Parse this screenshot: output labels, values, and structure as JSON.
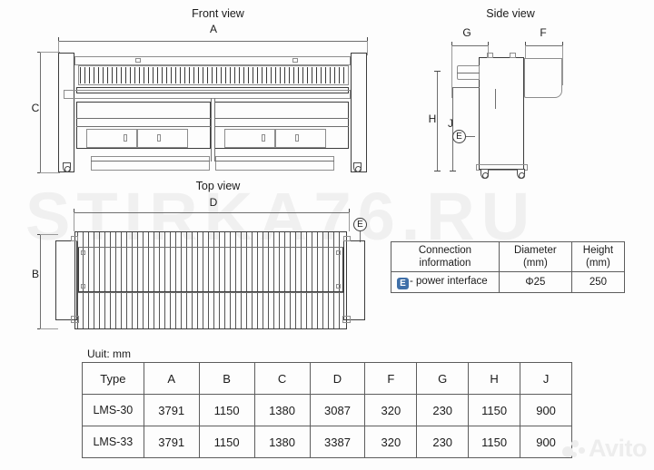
{
  "watermarks": {
    "site": "STIRKA76.RU",
    "marketplace": "Avito"
  },
  "views": {
    "front": {
      "title": "Front view",
      "dim_width_label": "A",
      "dim_height_label": "C"
    },
    "side": {
      "title": "Side view",
      "dim_g_label": "G",
      "dim_f_label": "F",
      "dim_h_label": "H",
      "dim_j_label": "J",
      "marker_e": "E"
    },
    "top": {
      "title": "Top view",
      "dim_width_label": "D",
      "dim_depth_label": "B",
      "marker_e": "E"
    }
  },
  "connection_table": {
    "headers": [
      "Connection\ninformation",
      "Diameter\n(mm)",
      "Height\n(mm)"
    ],
    "header_line1": [
      "Connection",
      "Diameter",
      "Height"
    ],
    "header_line2": [
      "information",
      "(mm)",
      "(mm)"
    ],
    "rows": [
      {
        "badge": "E",
        "label": "- power interface",
        "diameter": "Φ25",
        "height": "250"
      }
    ]
  },
  "spec_table": {
    "unit_note": "Uuit:  mm",
    "headers": [
      "Type",
      "A",
      "B",
      "C",
      "D",
      "F",
      "G",
      "H",
      "J"
    ],
    "rows": [
      [
        "LMS-30",
        "3791",
        "1150",
        "1380",
        "3087",
        "320",
        "230",
        "1150",
        "900"
      ],
      [
        "LMS-33",
        "3791",
        "1150",
        "1380",
        "3387",
        "320",
        "230",
        "1150",
        "900"
      ]
    ]
  },
  "colors": {
    "background": "#fdfdfd",
    "line": "#3c3c3c",
    "dim_line": "#6f6f6f",
    "badge_blue": "#3f6fa8",
    "watermark": "#f0f0f0"
  }
}
